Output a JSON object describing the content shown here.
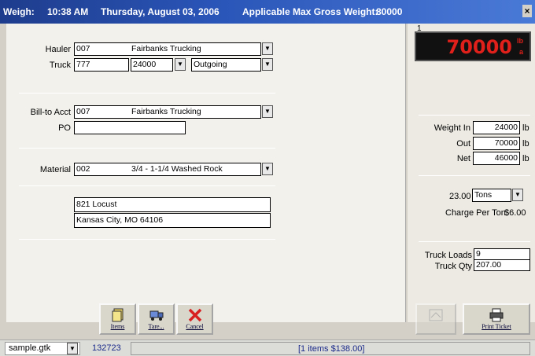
{
  "titlebar": {
    "weigh_label": "Weigh:",
    "time": "10:38 AM",
    "date": "Thursday, August 03, 2006",
    "max_gross_label": "Applicable Max Gross Weight:",
    "max_gross_value": "80000",
    "close": "×"
  },
  "form": {
    "hauler_label": "Hauler",
    "hauler_code": "007",
    "hauler_name": "Fairbanks Trucking",
    "truck_label": "Truck",
    "truck_code": "777",
    "truck_tare": "24000",
    "truck_direction": "Outgoing",
    "billto_label": "Bill-to Acct",
    "billto_code": "007",
    "billto_name": "Fairbanks Trucking",
    "po_label": "PO",
    "po_value": "",
    "material_label": "Material",
    "material_code": "002",
    "material_name": "3/4 - 1-1/4 Washed Rock",
    "address_line1": "821 Locust",
    "address_line2": "Kansas City, MO 64106"
  },
  "buttons": {
    "items": "Items",
    "tare": "Tare...",
    "cancel": "Cancel",
    "print_ticket": "Print Ticket"
  },
  "scale": {
    "index": "1",
    "reading": "70000",
    "unit_top": "lb",
    "unit_bottom": "a"
  },
  "weights": {
    "in_label": "Weight In",
    "in_value": "24000",
    "out_label": "Out",
    "out_value": "70000",
    "net_label": "Net",
    "net_value": "46000",
    "unit": "lb"
  },
  "charges": {
    "quantity": "23.00",
    "unit_select": "Tons",
    "charge_per_ton_label": "Charge Per Ton:",
    "charge_per_ton_value": "$6.00"
  },
  "loads": {
    "truck_loads_label": "Truck Loads",
    "truck_loads_value": "9",
    "truck_qty_label": "Truck Qty",
    "truck_qty_value": "207.00"
  },
  "status": {
    "file": "sample.gtk",
    "ticket_number": "132723",
    "summary": "[1 items  $138.00]"
  },
  "colors": {
    "titlebar": "#2a55b8",
    "scale_digits": "#e0201a",
    "status_text": "#1a2a8a"
  }
}
